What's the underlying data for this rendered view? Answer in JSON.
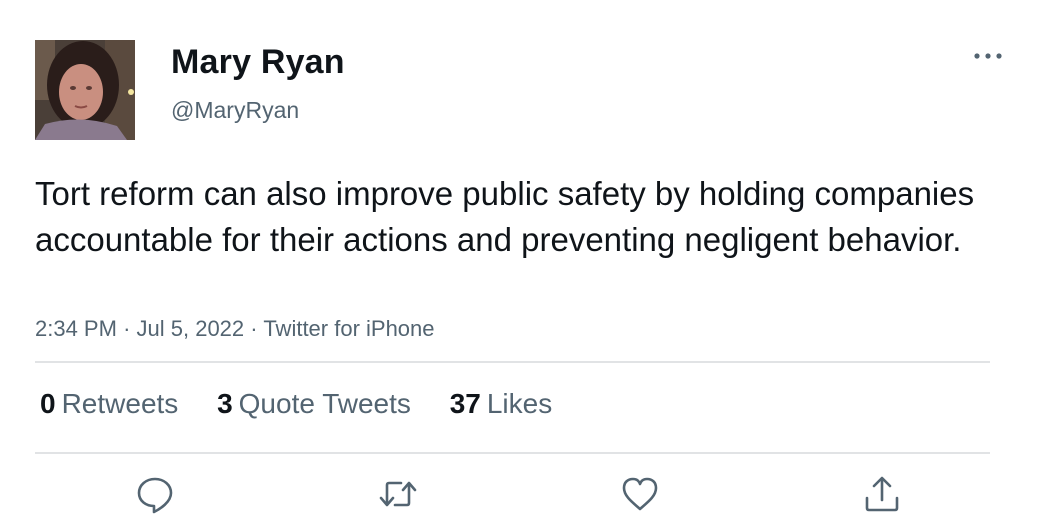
{
  "author": {
    "display_name": "Mary Ryan",
    "handle": "@MaryRyan"
  },
  "tweet": {
    "text": "Tort reform can also improve public safety by holding companies accountable for their actions and preventing negligent behavior.",
    "time": "2:34 PM",
    "separator": "·",
    "date": "Jul 5, 2022",
    "source": "Twitter for iPhone"
  },
  "stats": {
    "retweets_count": "0",
    "retweets_label": "Retweets",
    "quotes_count": "3",
    "quotes_label": "Quote Tweets",
    "likes_count": "37",
    "likes_label": "Likes"
  },
  "icons": {
    "more": "more-dots-icon",
    "reply": "reply-icon",
    "retweet": "retweet-icon",
    "like": "heart-icon",
    "share": "share-icon"
  },
  "colors": {
    "text": "#0f1419",
    "secondary": "#536471",
    "divider": "#e1e3e5"
  }
}
